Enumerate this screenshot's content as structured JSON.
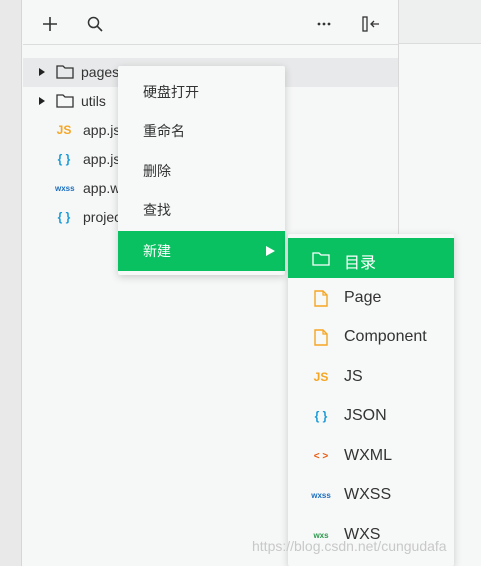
{
  "toolbar": {
    "buttons": [
      {
        "name": "add-icon",
        "glyph": "+"
      },
      {
        "name": "search-icon"
      },
      {
        "name": "more-icon",
        "glyph": "···"
      },
      {
        "name": "collapse-panel-icon"
      }
    ]
  },
  "tree": {
    "items": [
      {
        "label": "pages",
        "kind": "folder",
        "expandable": true,
        "selected": true
      },
      {
        "label": "utils",
        "kind": "folder",
        "expandable": true
      },
      {
        "label": "app.js",
        "kind": "js",
        "icon_text": "JS",
        "icon_color": "#f5a623"
      },
      {
        "label": "app.json",
        "kind": "json",
        "icon_text": "{ }",
        "icon_color": "#1a9bd7"
      },
      {
        "label": "app.wxss",
        "kind": "wxss",
        "icon_text": "wxss",
        "icon_color": "#1b6fbf"
      },
      {
        "label": "project.config.json",
        "kind": "json",
        "icon_text": "{ }",
        "icon_color": "#1a9bd7"
      }
    ]
  },
  "context_menu": {
    "items": [
      {
        "label": "硬盘打开"
      },
      {
        "label": "重命名"
      },
      {
        "label": "删除"
      },
      {
        "label": "查找"
      },
      {
        "label": "新建",
        "active": true,
        "has_submenu": true
      }
    ]
  },
  "submenu": {
    "items": [
      {
        "label": "目录",
        "icon": "folder-icon",
        "active": true
      },
      {
        "label": "Page",
        "icon": "file-icon",
        "icon_color": "#f5a623"
      },
      {
        "label": "Component",
        "icon": "file-icon",
        "icon_color": "#f5a623"
      },
      {
        "label": "JS",
        "icon": "js-icon",
        "icon_text": "JS",
        "icon_color": "#f5a623"
      },
      {
        "label": "JSON",
        "icon": "json-icon",
        "icon_text": "{ }",
        "icon_color": "#1a9bd7"
      },
      {
        "label": "WXML",
        "icon": "wxml-icon",
        "icon_text": "< >",
        "icon_color": "#e8590c"
      },
      {
        "label": "WXSS",
        "icon": "wxss-icon",
        "icon_text": "wxss",
        "icon_color": "#1b6fbf"
      },
      {
        "label": "WXS",
        "icon": "wxs-icon",
        "icon_text": "wxs",
        "icon_color": "#2e9a4f"
      }
    ]
  },
  "watermark": "https://blog.csdn.net/cungudafa",
  "colors": {
    "accent": "#09c160",
    "background": "#f6f7f7"
  }
}
